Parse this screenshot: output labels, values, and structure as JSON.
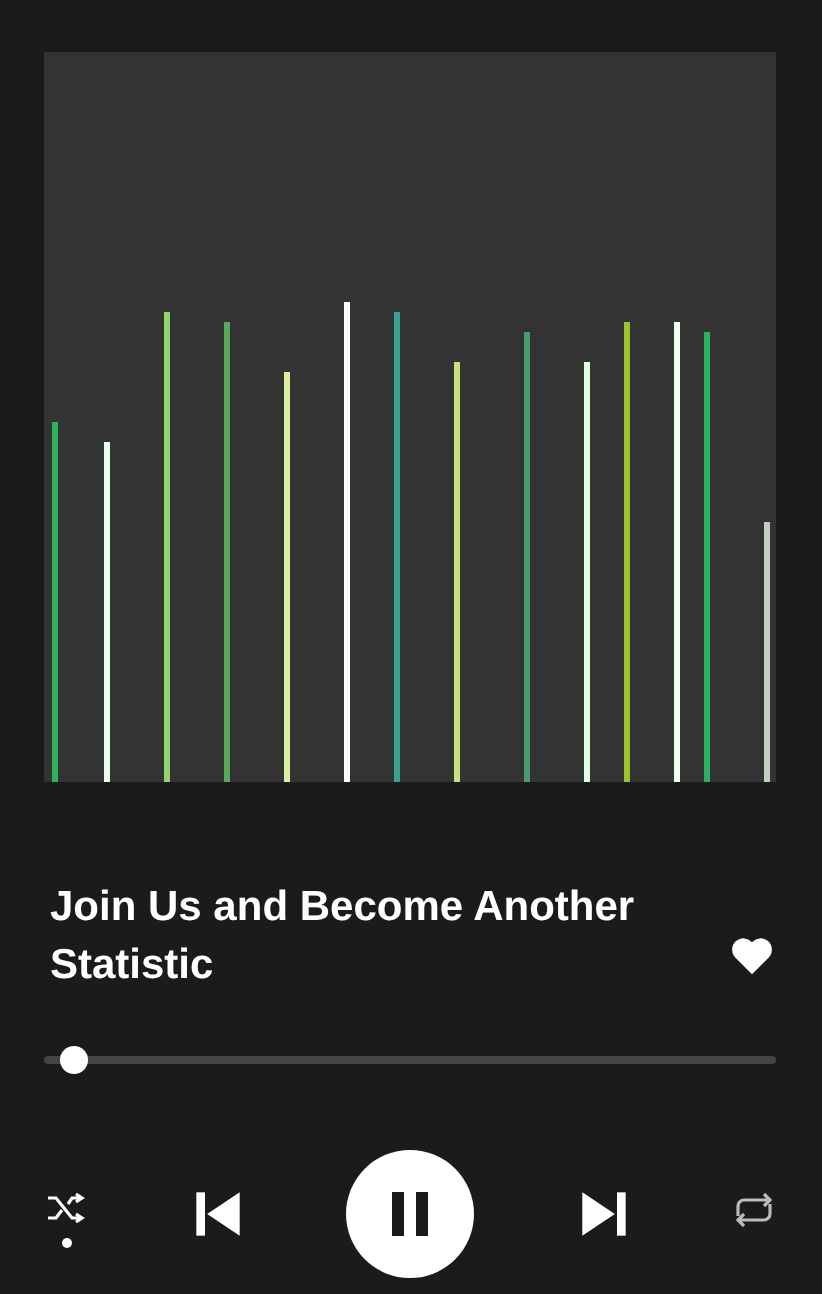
{
  "track": {
    "title": "Join Us and Become Another Statistic",
    "liked": true
  },
  "progress": {
    "level": 0.02
  },
  "controls": {
    "shuffle": true,
    "playing": true,
    "repeat": false
  }
}
